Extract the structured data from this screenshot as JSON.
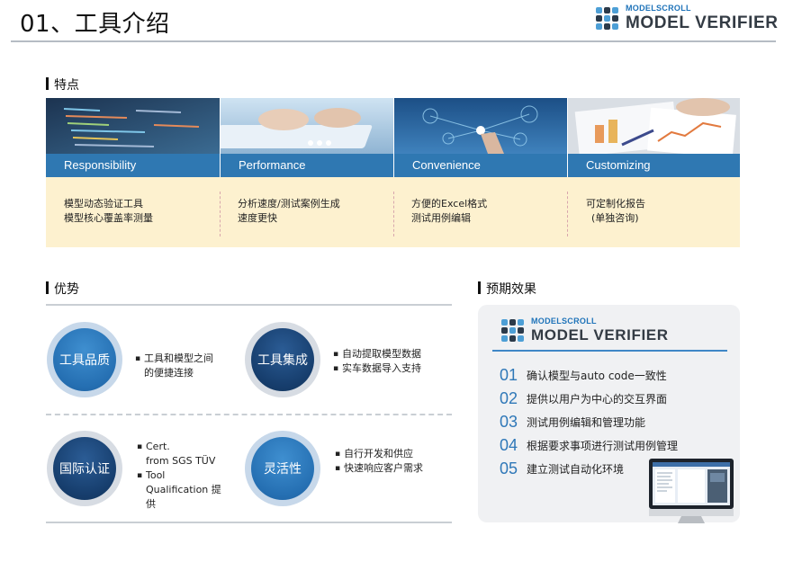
{
  "header": {
    "title": "01、工具介绍"
  },
  "brand": {
    "small": "MODELSCROLL",
    "big": "MODEL VERIFIER",
    "mark_colors": [
      "#4d9fd6",
      "#2b3a4a",
      "#4d9fd6",
      "#2b3a4a",
      "#4d9fd6",
      "#2b3a4a",
      "#4d9fd6",
      "#2b3a4a",
      "#4d9fd6"
    ]
  },
  "features": {
    "label": "特点",
    "items": [
      {
        "name": "Responsibility",
        "lines": [
          "模型动态验证工具",
          "模型核心覆盖率测量"
        ]
      },
      {
        "name": "Performance",
        "lines": [
          "分析速度/测试案例生成",
          "速度更快"
        ]
      },
      {
        "name": "Convenience",
        "lines": [
          "方便的Excel格式",
          "测试用例编辑"
        ]
      },
      {
        "name": "Customizing",
        "lines": [
          "可定制化报告",
          "(单独咨询)"
        ]
      }
    ]
  },
  "advantages": {
    "label": "优势",
    "items": [
      {
        "title": "工具品质",
        "bullets": [
          "工具和模型之间",
          "的便捷连接"
        ]
      },
      {
        "title": "工具集成",
        "bullets": [
          "自动提取模型数据",
          "实车数据导入支持"
        ]
      },
      {
        "title": "国际认证",
        "bullets": [
          "Cert.",
          "from SGS TÜV",
          "Tool",
          "Qualification 提",
          "供"
        ]
      },
      {
        "title": "灵活性",
        "bullets": [
          "自行开发和供应",
          "快速响应客户需求"
        ]
      }
    ]
  },
  "effects": {
    "label": "预期效果",
    "items": [
      {
        "num": "01",
        "text": "确认模型与auto code一致性"
      },
      {
        "num": "02",
        "text": "提供以用户为中心的交互界面"
      },
      {
        "num": "03",
        "text": "测试用例编辑和管理功能"
      },
      {
        "num": "04",
        "text": "根据要求事项进行测试用例管理"
      },
      {
        "num": "05",
        "text": "建立测试自动化环境"
      }
    ]
  },
  "colors": {
    "accent": "#2f78b2",
    "feature_bg": "#fdf1cf",
    "circle_dark": "#163d6c",
    "circle_blue": "#256fb2"
  }
}
